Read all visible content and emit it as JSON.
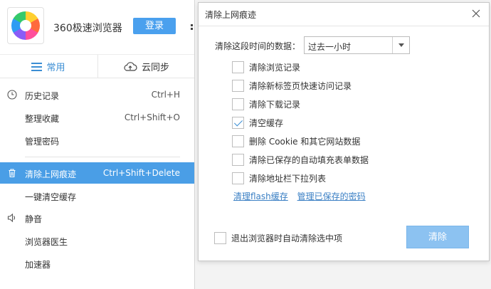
{
  "browser": {
    "app_name": "360极速浏览器",
    "login_label": "登录",
    "tabs": [
      {
        "label": "常用",
        "icon": "menu-icon"
      },
      {
        "label": "云同步",
        "icon": "cloud-sync-icon"
      }
    ],
    "menu_items": [
      {
        "label": "历史记录",
        "shortcut": "Ctrl+H",
        "icon": "clock-icon"
      },
      {
        "label": "整理收藏",
        "shortcut": "Ctrl+Shift+O",
        "icon": ""
      },
      {
        "label": "管理密码",
        "shortcut": "",
        "icon": ""
      },
      {
        "label": "清除上网痕迹",
        "shortcut": "Ctrl+Shift+Delete",
        "icon": "trash-icon",
        "selected": true
      },
      {
        "label": "一键清空缓存",
        "shortcut": "",
        "icon": ""
      },
      {
        "label": "静音",
        "shortcut": "",
        "icon": "speaker-icon"
      },
      {
        "label": "浏览器医生",
        "shortcut": "",
        "icon": ""
      },
      {
        "label": "加速器",
        "shortcut": "",
        "icon": ""
      }
    ]
  },
  "dialog": {
    "title": "清除上网痕迹",
    "range_label": "清除这段时间的数据：",
    "range_value": "过去一小时",
    "options": [
      {
        "label": "清除浏览记录",
        "checked": false
      },
      {
        "label": "清除新标签页快速访问记录",
        "checked": false
      },
      {
        "label": "清除下载记录",
        "checked": false
      },
      {
        "label": "清空缓存",
        "checked": true
      },
      {
        "label": "删除 Cookie 和其它网站数据",
        "checked": false
      },
      {
        "label": "清除已保存的自动填充表单数据",
        "checked": false
      },
      {
        "label": "清除地址栏下拉列表",
        "checked": false
      }
    ],
    "links": [
      "清理flash缓存",
      "管理已保存的密码"
    ],
    "exit_option": {
      "label": "退出浏览器时自动清除选中项",
      "checked": false
    },
    "clear_button": "清除"
  },
  "colors": {
    "accent": "#4a9ee6",
    "login_button": "#4aa0ee",
    "clear_button": "#8cc2f1",
    "link": "#3a7fc4"
  }
}
